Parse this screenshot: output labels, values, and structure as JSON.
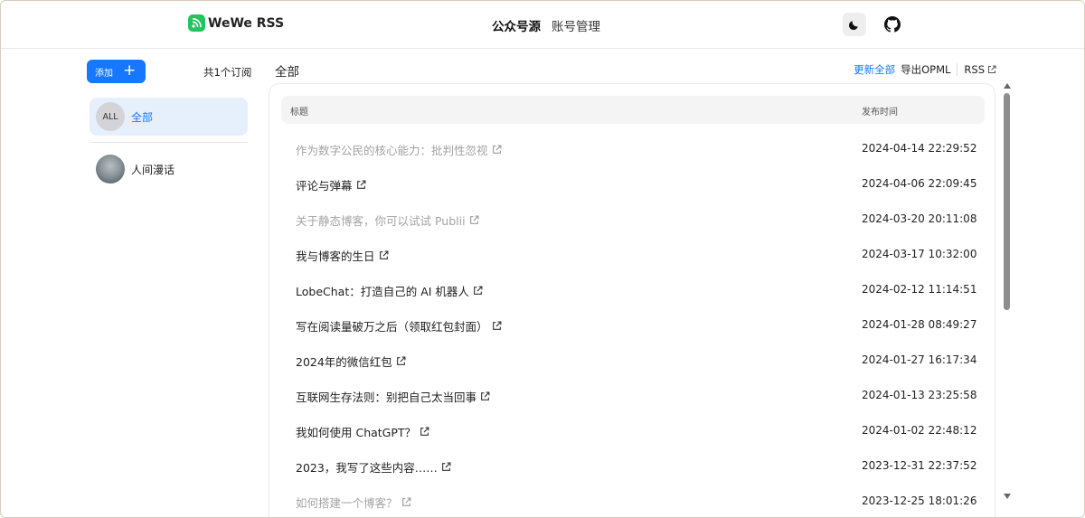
{
  "header": {
    "brand": "WeWe RSS",
    "nav": [
      {
        "label": "公众号源",
        "active": true
      },
      {
        "label": "账号管理",
        "active": false
      }
    ],
    "theme_icon": "moon-icon",
    "github_icon": "github-icon"
  },
  "sidebar": {
    "add_label": "添加",
    "count_label": "共1个订阅",
    "items": [
      {
        "avatar_text": "ALL",
        "label": "全部",
        "active": true
      },
      {
        "avatar_text": "",
        "label": "人间漫话",
        "active": false
      }
    ]
  },
  "main": {
    "title": "全部",
    "actions": {
      "refresh_all": "更新全部",
      "export_opml": "导出OPML",
      "rss": "RSS"
    },
    "table": {
      "headers": {
        "title": "标题",
        "time": "发布时间"
      },
      "rows": [
        {
          "title": "作为数字公民的核心能力：批判性忽视",
          "time": "2024-04-14 22:29:52",
          "read": true
        },
        {
          "title": "评论与弹幕",
          "time": "2024-04-06 22:09:45",
          "read": false
        },
        {
          "title": "关于静态博客，你可以试试 Publii",
          "time": "2024-03-20 20:11:08",
          "read": true
        },
        {
          "title": "我与博客的生日",
          "time": "2024-03-17 10:32:00",
          "read": false
        },
        {
          "title": "LobeChat：打造自己的 AI 机器人",
          "time": "2024-02-12 11:14:51",
          "read": false
        },
        {
          "title": "写在阅读量破万之后（领取红包封面）",
          "time": "2024-01-28 08:49:27",
          "read": false
        },
        {
          "title": "2024年的微信红包",
          "time": "2024-01-27 16:17:34",
          "read": false
        },
        {
          "title": "互联网生存法则：别把自己太当回事",
          "time": "2024-01-13 23:25:58",
          "read": false
        },
        {
          "title": "我如何使用 ChatGPT？",
          "time": "2024-01-02 22:48:12",
          "read": false
        },
        {
          "title": "2023，我写了这些内容……",
          "time": "2023-12-31 22:37:52",
          "read": false
        },
        {
          "title": "如何搭建一个博客？",
          "time": "2023-12-25 18:01:26",
          "read": true
        }
      ]
    }
  },
  "colors": {
    "accent": "#1677ff",
    "brand": "#22c55e",
    "read_text": "#a3a3a3"
  }
}
